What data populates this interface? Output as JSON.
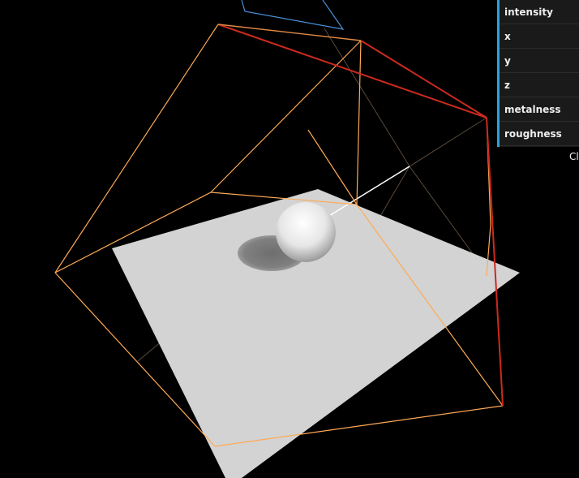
{
  "gui": {
    "controls": [
      {
        "label": "intensity"
      },
      {
        "label": "x"
      },
      {
        "label": "y"
      },
      {
        "label": "z"
      },
      {
        "label": "metalness"
      },
      {
        "label": "roughness"
      }
    ],
    "close_label": "Cl",
    "accent_color": "#2fa1d6",
    "panel_bg": "#1a1a1a"
  },
  "scene": {
    "background": "#000000",
    "plane_color": "#d3d3d3",
    "frustum_color": "#ffaa55",
    "frustum_edge_color": "#cc2a1e",
    "helper_color": "#4a90d9",
    "shadow_color": "#7a7a7a",
    "sphere_color": "#ffffff"
  }
}
